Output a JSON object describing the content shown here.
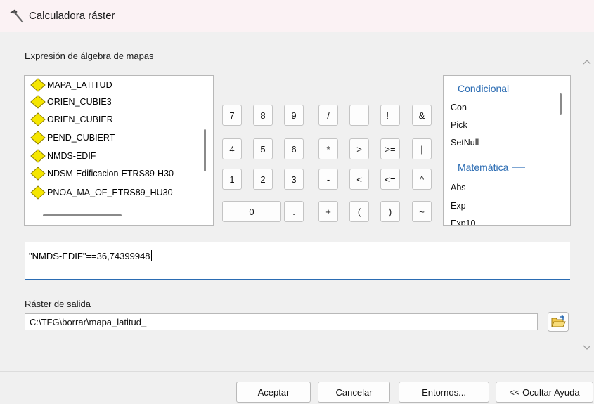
{
  "window": {
    "title": "Calculadora ráster"
  },
  "expression_label": "Expresión de álgebra de mapas",
  "layers": [
    "MAPA_LATITUD",
    "ORIEN_CUBIE3",
    "ORIEN_CUBIER",
    "PEND_CUBIERT",
    "NMDS-EDIF",
    "NDSM-Edificacion-ETRS89-H30",
    "PNOA_MA_OF_ETRS89_HU30"
  ],
  "keypad": {
    "k7": "7",
    "k8": "8",
    "k9": "9",
    "div": "/",
    "eq": "==",
    "ne": "!=",
    "and": "&",
    "k4": "4",
    "k5": "5",
    "k6": "6",
    "mul": "*",
    "gt": ">",
    "ge": ">=",
    "or": "|",
    "k1": "1",
    "k2": "2",
    "k3": "3",
    "sub": "-",
    "lt": "<",
    "le": "<=",
    "xor": "^",
    "k0": "0",
    "dot": ".",
    "add": "+",
    "lp": "(",
    "rp": ")",
    "not": "~"
  },
  "functions": {
    "cat1": "Condicional",
    "items1": [
      "Con",
      "Pick",
      "SetNull"
    ],
    "cat2": "Matemática",
    "items2": [
      "Abs",
      "Exp",
      "Exp10"
    ]
  },
  "expression": "\"NMDS-EDIF\"==36,74399948",
  "output": {
    "label": "Ráster de salida",
    "value": "C:\\TFG\\borrar\\mapa_latitud_"
  },
  "buttons": {
    "ok": "Aceptar",
    "cancel": "Cancelar",
    "environments": "Entornos...",
    "help": "<< Ocultar Ayuda"
  },
  "colors": {
    "accent": "#2b6cb3",
    "diamond": "#f5e600",
    "diamond_border": "#8a7a00",
    "titlebar": "#fbf2f4"
  }
}
